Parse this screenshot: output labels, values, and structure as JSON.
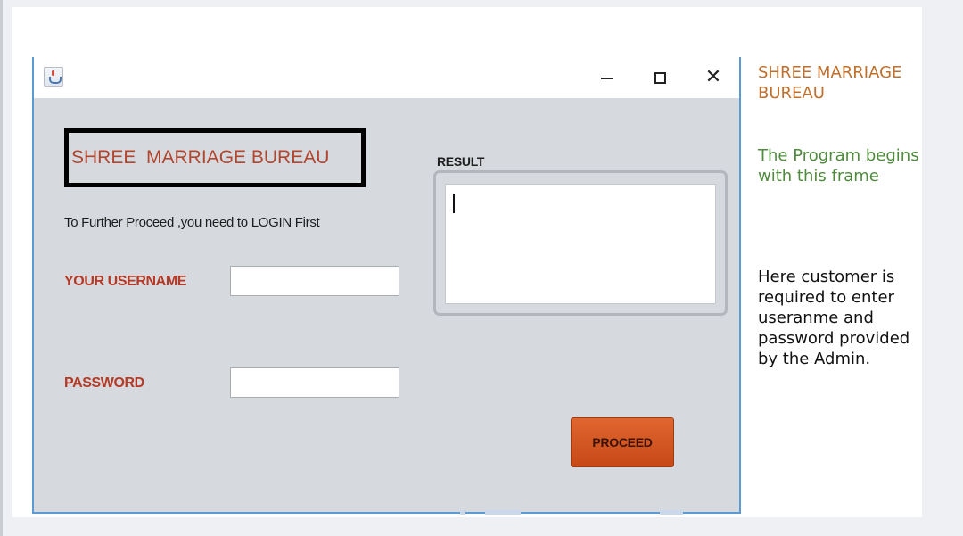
{
  "window": {
    "icon": "java-icon",
    "controls": {
      "minimize": "minimize-icon",
      "maximize": "maximize-icon",
      "close": "✕"
    }
  },
  "form": {
    "brand_title": "SHREE  MARRIAGE BUREAU",
    "login_hint": "To Further Proceed ,you need to LOGIN First",
    "username_label": "YOUR USERNAME",
    "username_value": "",
    "password_label": "PASSWORD",
    "password_value": "",
    "result_label": "RESULT",
    "result_value": "",
    "proceed_label": "PROCEED"
  },
  "notes": {
    "title": "SHREE MARRIAGE BUREAU",
    "intro": "The Program begins with  this frame",
    "description": "Here customer is required to enter useranme and password provided by the Admin."
  },
  "colors": {
    "brand_text": "#b2452e",
    "label_text": "#b53a25",
    "proceed_button": "#d4561f",
    "note_title": "#c0702e",
    "note_intro": "#4f8b3c",
    "window_border": "#5b9ad2"
  }
}
